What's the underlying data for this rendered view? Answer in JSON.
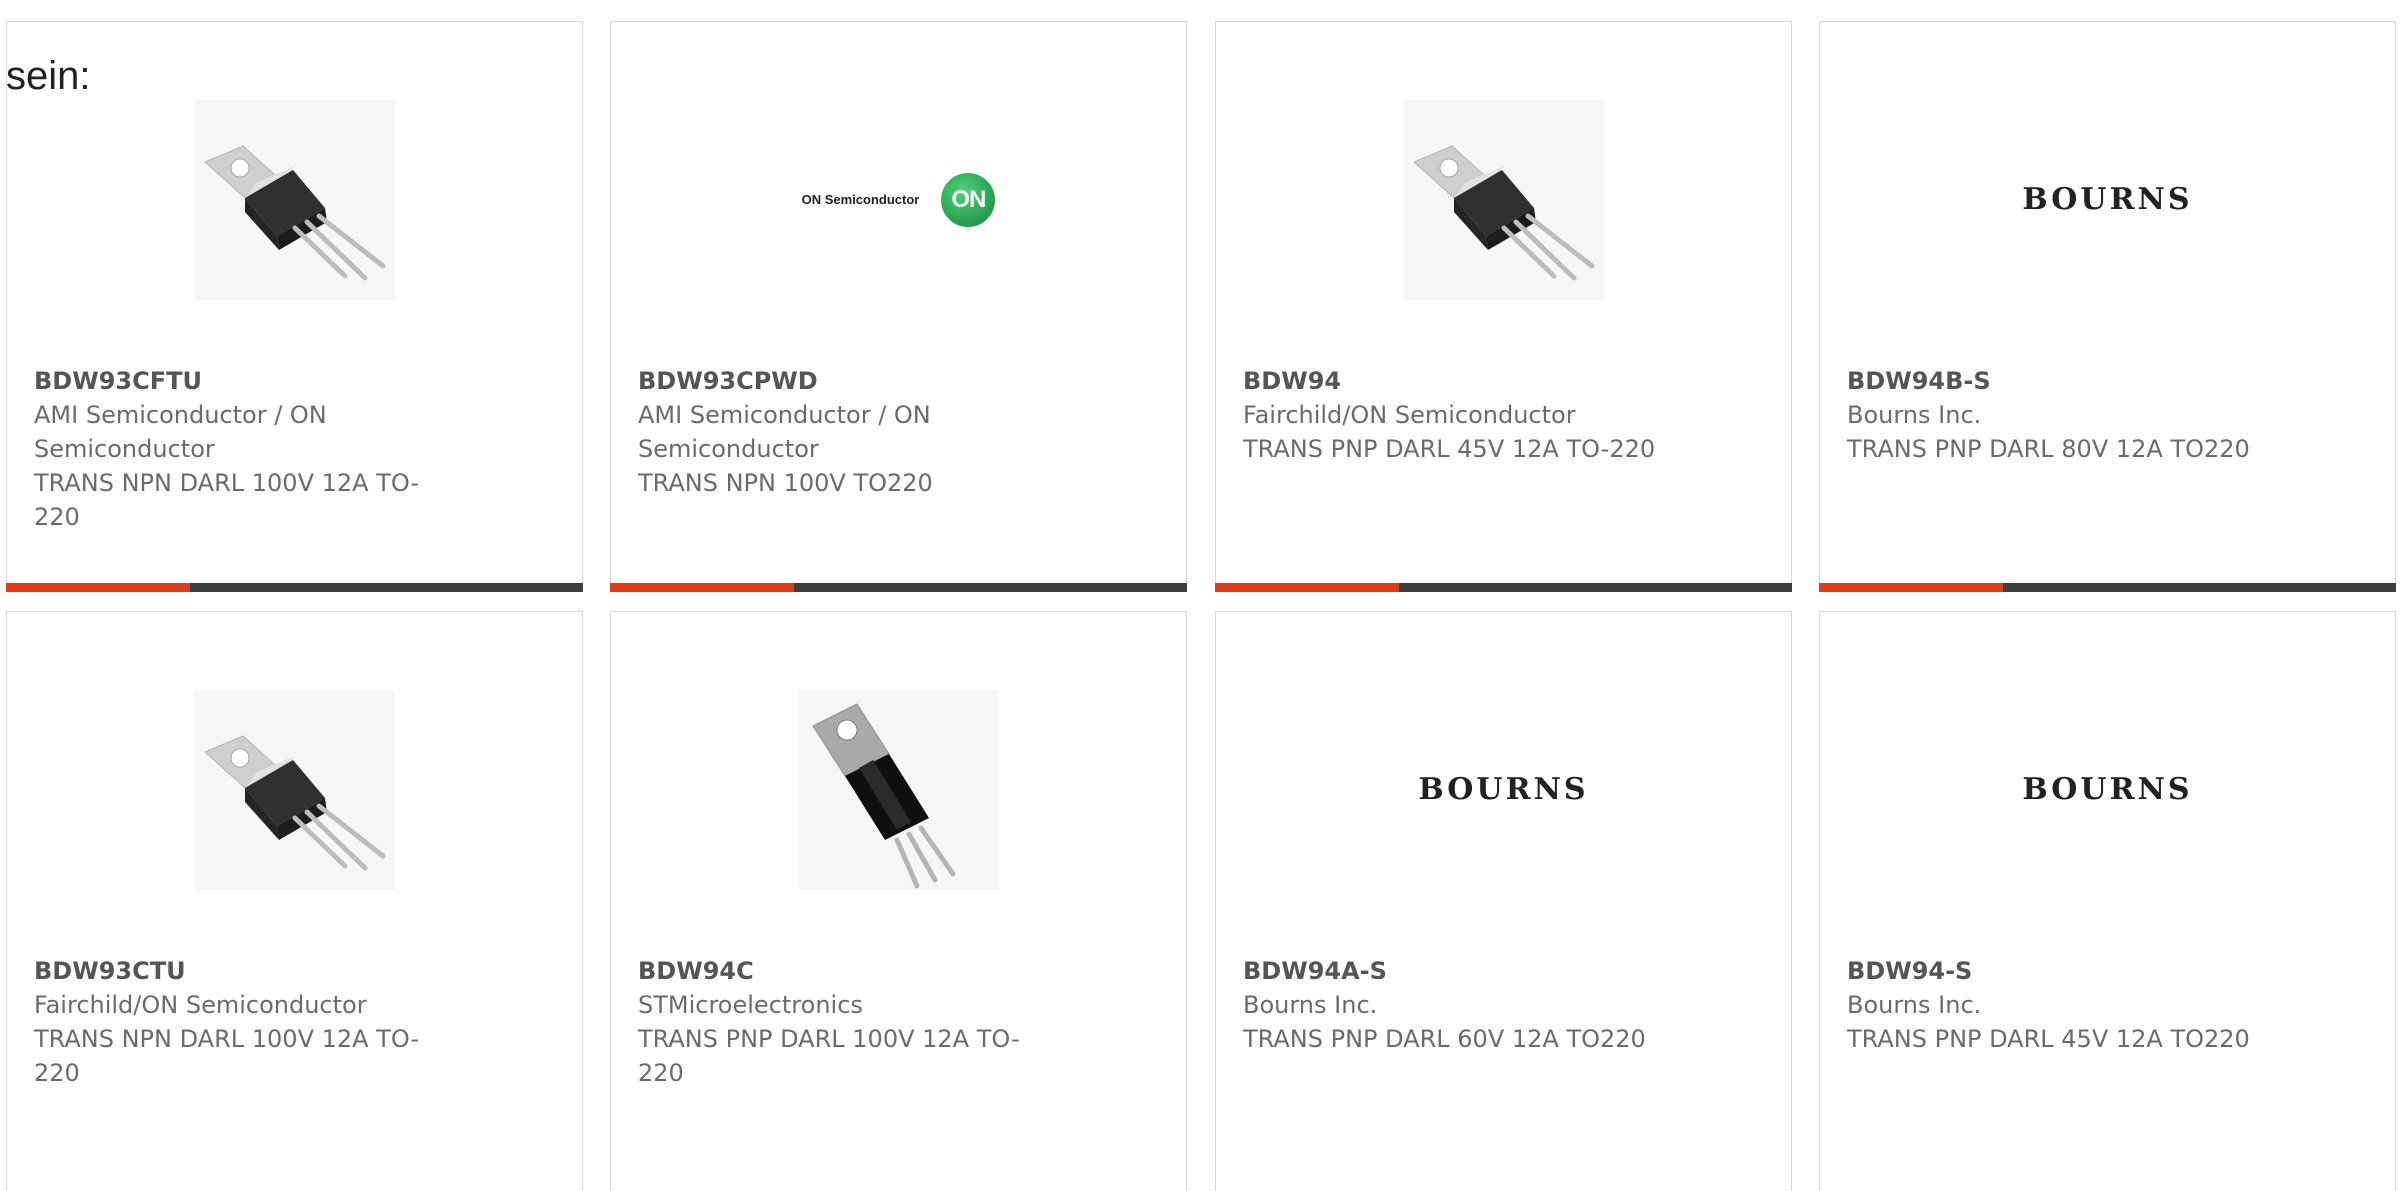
{
  "intro_text": "sein:",
  "cards": [
    {
      "part": "BDW93CFTU",
      "manufacturer": "AMI Semiconductor / ON Semiconductor",
      "description": "TRANS NPN DARL 100V 12A TO-220",
      "image": "to220-transistor-icon"
    },
    {
      "part": "BDW93CPWD",
      "manufacturer": "AMI Semiconductor / ON Semiconductor",
      "description": "TRANS NPN 100V TO220",
      "image": "on-semiconductor-logo",
      "logo_text": "ON Semiconductor",
      "logo_mark": "ON"
    },
    {
      "part": "BDW94",
      "manufacturer": "Fairchild/ON Semiconductor",
      "description": "TRANS PNP DARL 45V 12A TO-220",
      "image": "to220-transistor-icon"
    },
    {
      "part": "BDW94B-S",
      "manufacturer": "Bourns Inc.",
      "description": "TRANS PNP DARL 80V 12A TO220",
      "image": "bourns-logo",
      "logo_text": "BOURNS"
    },
    {
      "part": "BDW93CTU",
      "manufacturer": "Fairchild/ON Semiconductor",
      "description": "TRANS NPN DARL 100V 12A TO-220",
      "image": "to220-transistor-icon"
    },
    {
      "part": "BDW94C",
      "manufacturer": "STMicroelectronics",
      "description": "TRANS PNP DARL 100V 12A TO-220",
      "image": "to220-transistor-photo"
    },
    {
      "part": "BDW94A-S",
      "manufacturer": "Bourns Inc.",
      "description": "TRANS PNP DARL 60V 12A TO220",
      "image": "bourns-logo",
      "logo_text": "BOURNS"
    },
    {
      "part": "BDW94-S",
      "manufacturer": "Bourns Inc.",
      "description": "TRANS PNP DARL 45V 12A TO220",
      "image": "bourns-logo",
      "logo_text": "BOURNS"
    }
  ],
  "colors": {
    "accent": "#e13a14",
    "bar": "#3d3d3d",
    "text": "#6b6b6b",
    "part": "#555555",
    "border": "#d9d9d9"
  }
}
